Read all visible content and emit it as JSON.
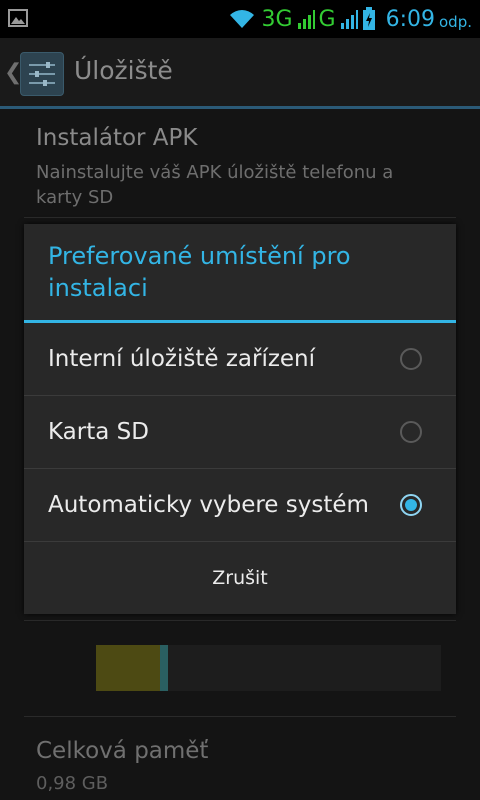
{
  "status_bar": {
    "network_3g": "3G",
    "network_g": "G",
    "time": "6:09",
    "ampm": "odp."
  },
  "action_bar": {
    "title": "Úložiště"
  },
  "background_list": {
    "apk_title": "Instalátor APK",
    "apk_summary": "Nainstalujte váš APK úložiště telefonu a karty SD",
    "total_title": "Celková paměť",
    "total_value": "0,98 GB",
    "storage_used_fraction": 0.21
  },
  "dialog": {
    "title": "Preferované umístění pro instalaci",
    "options": [
      {
        "label": "Interní úložiště zařízení",
        "checked": false
      },
      {
        "label": "Karta SD",
        "checked": false
      },
      {
        "label": "Automaticky vybere systém",
        "checked": true
      }
    ],
    "cancel_label": "Zrušit"
  },
  "colors": {
    "accent": "#33b5e5",
    "network": "#33cc33"
  }
}
